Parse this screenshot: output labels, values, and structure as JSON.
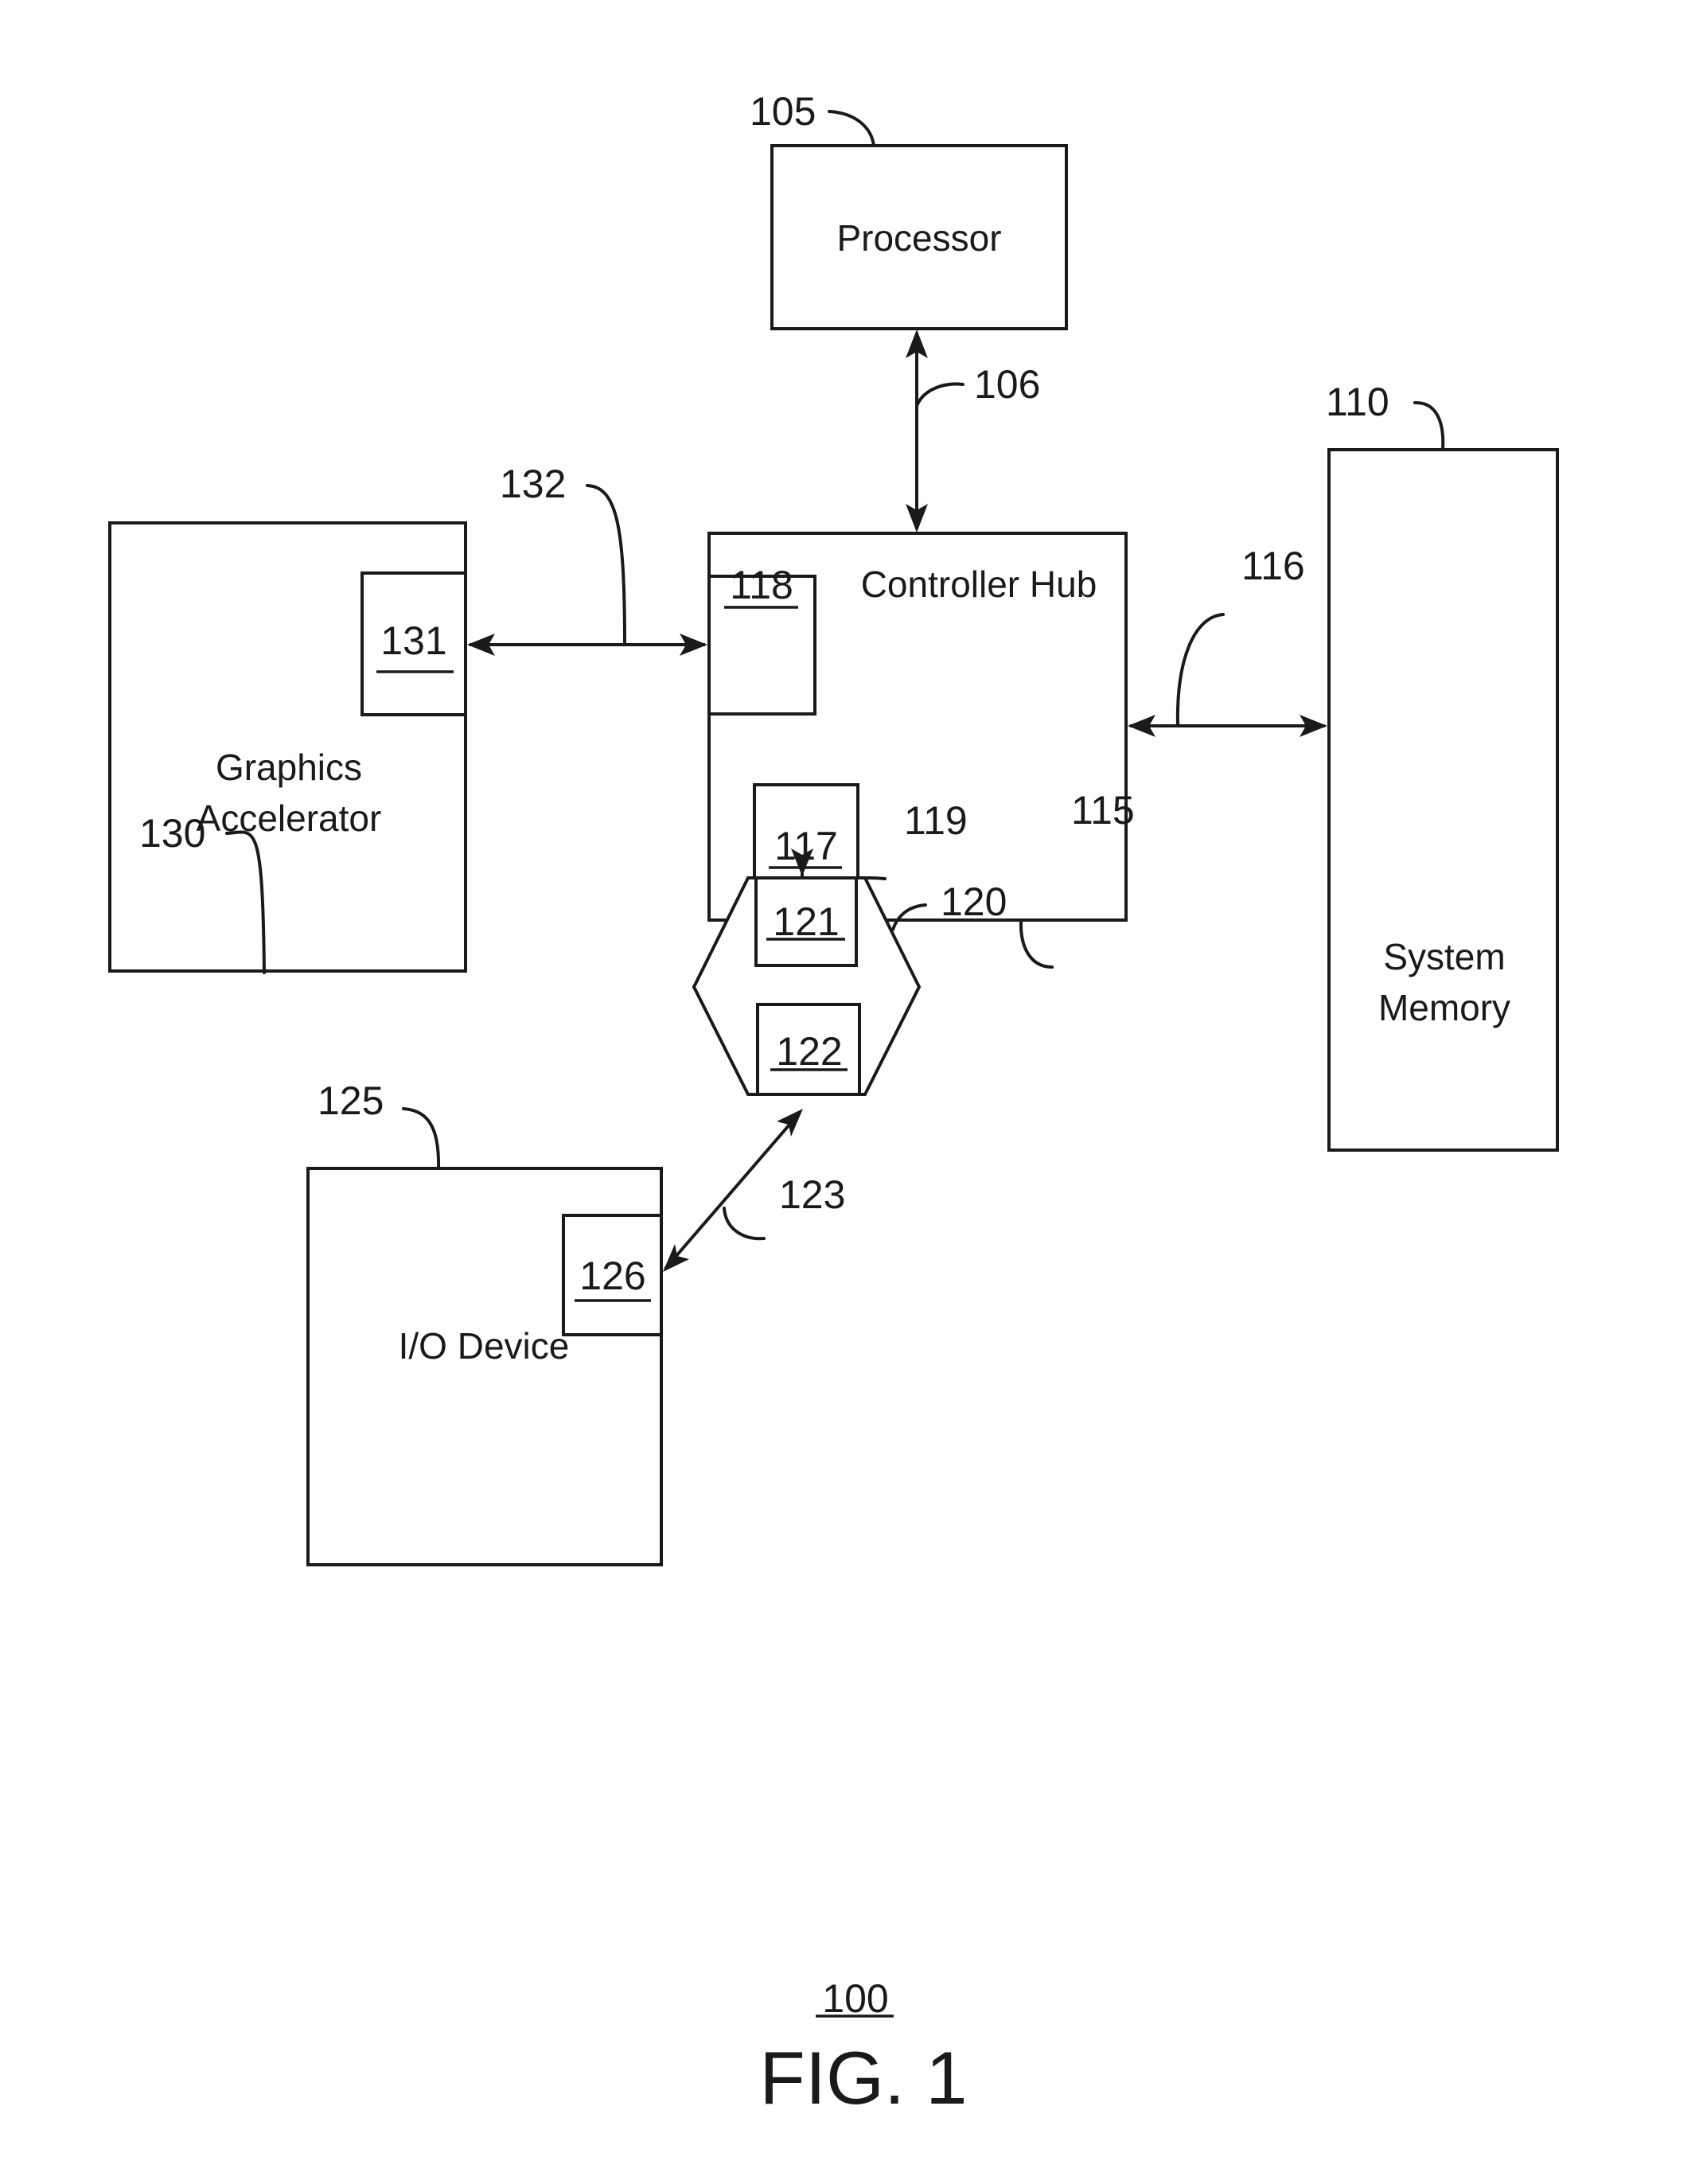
{
  "figure": {
    "reference": "100",
    "caption": "FIG. 1"
  },
  "blocks": {
    "processor": {
      "label": "Processor",
      "ref": "105"
    },
    "system_memory": {
      "label_line1": "System",
      "label_line2": "Memory",
      "ref": "110"
    },
    "controller_hub": {
      "label": "Controller Hub",
      "ref": "115",
      "port_upstream": "118",
      "port_downstream": "117"
    },
    "switch": {
      "ref": "120",
      "port_upstream": "121",
      "port_downstream": "122"
    },
    "io_device": {
      "label": "I/O Device",
      "ref": "125",
      "port": "126"
    },
    "graphics_accelerator": {
      "label_line1": "Graphics",
      "label_line2": "Accelerator",
      "ref": "130",
      "port": "131"
    }
  },
  "links": {
    "processor_hub": "106",
    "hub_memory": "116",
    "hub_switch": "119",
    "switch_io": "123",
    "graphics_hub": "132"
  }
}
